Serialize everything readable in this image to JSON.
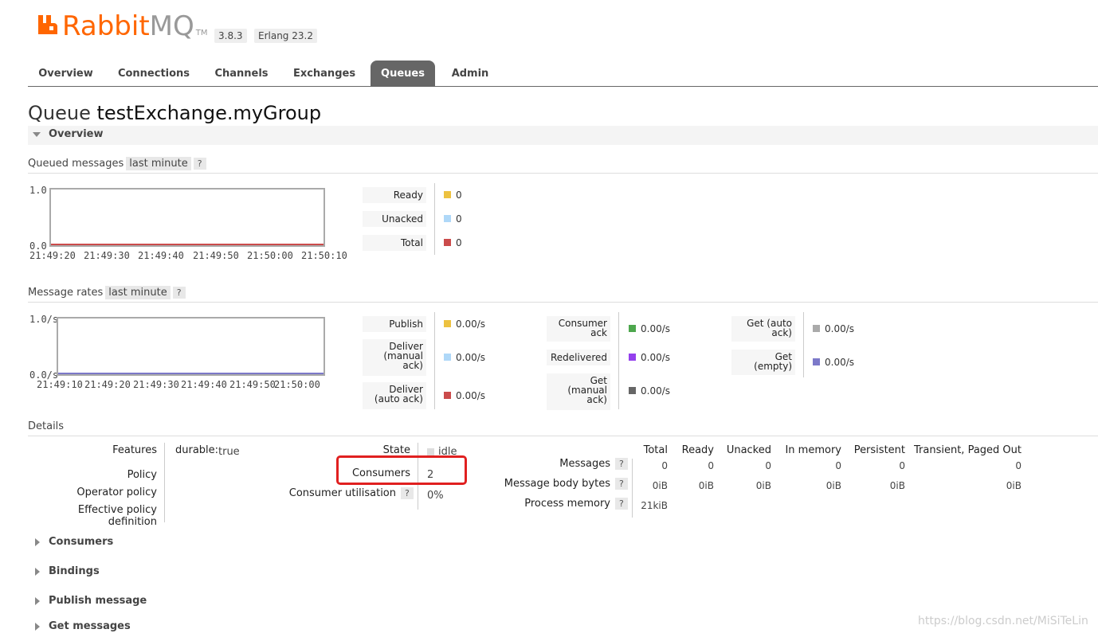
{
  "header": {
    "logo_rabbit": "Rabbit",
    "logo_mq": "MQ",
    "logo_tm": "TM",
    "version": "3.8.3",
    "erlang": "Erlang 23.2"
  },
  "nav": {
    "tabs": [
      {
        "label": "Overview"
      },
      {
        "label": "Connections"
      },
      {
        "label": "Channels"
      },
      {
        "label": "Exchanges"
      },
      {
        "label": "Queues",
        "active": true
      },
      {
        "label": "Admin"
      }
    ]
  },
  "page": {
    "prefix": "Queue",
    "name": "testExchange.myGroup"
  },
  "overview": {
    "label": "Overview",
    "queued": {
      "title": "Queued messages",
      "range": "last minute",
      "help": "?",
      "y_top": "1.0",
      "y_bottom": "0.0",
      "x_ticks": [
        "21:49:20",
        "21:49:30",
        "21:49:40",
        "21:49:50",
        "21:50:00",
        "21:50:10"
      ],
      "legend": [
        {
          "label": "Ready",
          "value": "0",
          "color": "#edc240"
        },
        {
          "label": "Unacked",
          "value": "0",
          "color": "#afd8f8"
        },
        {
          "label": "Total",
          "value": "0",
          "color": "#cb4b4b"
        }
      ]
    },
    "rates": {
      "title": "Message rates",
      "range": "last minute",
      "help": "?",
      "y_top": "1.0/s",
      "y_bottom": "0.0/s",
      "x_ticks": [
        "21:49:10",
        "21:49:20",
        "21:49:30",
        "21:49:40",
        "21:49:50",
        "21:50:00"
      ],
      "legend": [
        {
          "label": "Publish",
          "value": "0.00/s",
          "color": "#edc240"
        },
        {
          "label": "Deliver (manual ack)",
          "value": "0.00/s",
          "color": "#afd8f8"
        },
        {
          "label": "Deliver (auto ack)",
          "value": "0.00/s",
          "color": "#cb4b4b"
        },
        {
          "label": "Consumer ack",
          "value": "0.00/s",
          "color": "#4da74d"
        },
        {
          "label": "Redelivered",
          "value": "0.00/s",
          "color": "#9440ed"
        },
        {
          "label": "Get (manual ack)",
          "value": "0.00/s",
          "color": "#666666"
        },
        {
          "label": "Get (auto ack)",
          "value": "0.00/s",
          "color": "#aaaaaa"
        },
        {
          "label": "Get (empty)",
          "value": "0.00/s",
          "color": "#7c79c9"
        }
      ]
    }
  },
  "details": {
    "title": "Details",
    "features_label": "Features",
    "durable_key": "durable:",
    "durable_val": "true",
    "policy_label": "Policy",
    "operator_policy_label": "Operator policy",
    "effective_policy_label": "Effective policy definition",
    "state_label": "State",
    "state_val": "idle",
    "consumers_label": "Consumers",
    "consumers_val": "2",
    "utilisation_label": "Consumer utilisation",
    "utilisation_help": "?",
    "utilisation_val": "0%",
    "columns": [
      "Total",
      "Ready",
      "Unacked",
      "In memory",
      "Persistent",
      "Transient, Paged Out"
    ],
    "rows": [
      {
        "label": "Messages",
        "help": "?",
        "values": [
          "0",
          "0",
          "0",
          "0",
          "0",
          "0"
        ]
      },
      {
        "label": "Message body bytes",
        "help": "?",
        "values": [
          "0iB",
          "0iB",
          "0iB",
          "0iB",
          "0iB",
          "0iB"
        ]
      },
      {
        "label": "Process memory",
        "help": "?",
        "values": [
          "21kiB"
        ]
      }
    ]
  },
  "sections": [
    "Consumers",
    "Bindings",
    "Publish message",
    "Get messages"
  ],
  "watermark": "https://blog.csdn.net/MiSiTeLin"
}
